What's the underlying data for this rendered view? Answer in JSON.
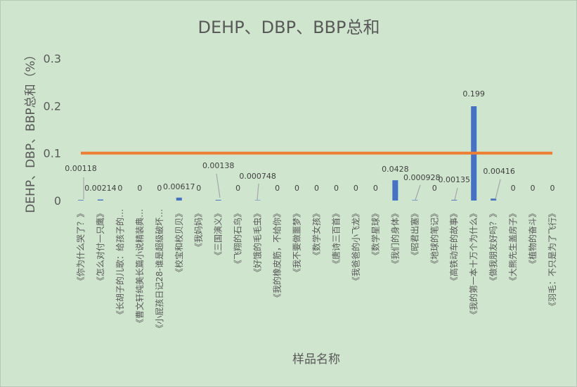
{
  "chart_data": {
    "type": "bar",
    "title": "DEHP、DBP、BBP总和",
    "xlabel": "样品名称",
    "ylabel": "DEHP、DBP、BBP总和（%）",
    "ylim": [
      0,
      0.3
    ],
    "yticks": [
      "0",
      "0.1",
      "0.2",
      "0.3"
    ],
    "grid": false,
    "legend": "none",
    "categories": [
      "《你为什么哭了？》",
      "《怎么对付一只鹰》",
      "《长胡子的儿歌：给孩子的…",
      "《曹文轩纯美长篇小说精装典…",
      "《小屁孩日记28-谁是超级破坏…",
      "《校宝和校贝贝》",
      "《我妈妈》",
      "《三国演义》",
      "《飞翔的石鸟》",
      "《好饿的毛毛虫》",
      "《我的橡皮筋，不给你》",
      "《我不要做噩梦》",
      "《数学女孩》",
      "《唐诗三百首》",
      "《我爸爸的小飞龙》",
      "《数学星球》",
      "《我们的身体》",
      "《昭君出塞》",
      "《地球的笔记》",
      "《高铁动车的故事》",
      "《我的第一本十万个为什么》",
      "《做我朋友好吗？》",
      "《大熊先生盖房子》",
      "《植物的奋斗》",
      "《羽毛：不只是为了飞行》"
    ],
    "series": [
      {
        "type": "bar",
        "color": "#4472c4",
        "values": [
          0.00118,
          0.00214,
          0,
          0,
          0,
          0.00617,
          0,
          0.00138,
          0,
          0.000748,
          0,
          0,
          0,
          0,
          0,
          0,
          0.0428,
          0.000928,
          0,
          0.00135,
          0.199,
          0.00416,
          0,
          0,
          0
        ],
        "data_labels": [
          "0.00118",
          "0.00214",
          "0",
          "0",
          "0",
          "0.00617",
          "0",
          "0.00138",
          "0",
          "0.000748",
          "0",
          "0",
          "0",
          "0",
          "0",
          "0",
          "0.0428",
          "0.000928",
          "0",
          "0.00135",
          "0.199",
          "0.00416",
          "0",
          "0",
          "0"
        ]
      },
      {
        "type": "line",
        "color": "#ed7d31",
        "values": [
          0.1,
          0.1,
          0.1,
          0.1,
          0.1,
          0.1,
          0.1,
          0.1,
          0.1,
          0.1,
          0.1,
          0.1,
          0.1,
          0.1,
          0.1,
          0.1,
          0.1,
          0.1,
          0.1,
          0.1,
          0.1,
          0.1,
          0.1,
          0.1,
          0.1
        ]
      }
    ]
  }
}
